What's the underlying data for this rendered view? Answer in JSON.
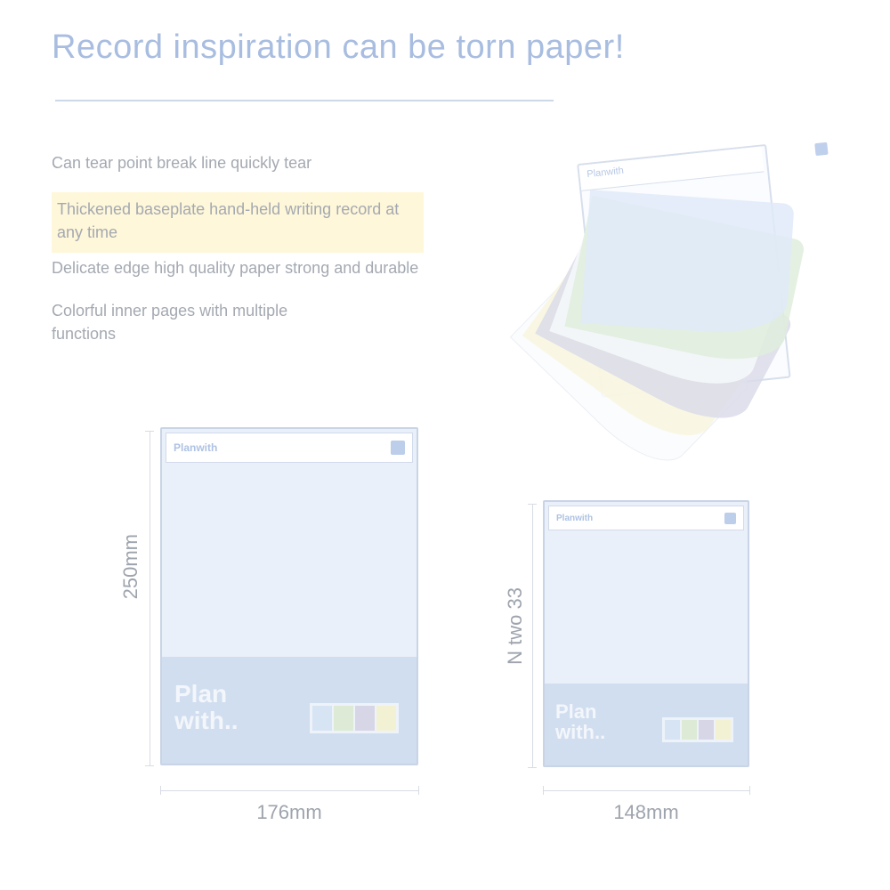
{
  "title": "Record inspiration can be torn paper!",
  "features": [
    "Can tear point break line quickly tear",
    "Thickened baseplate hand-held writing record at any time",
    "Delicate edge high quality paper strong and durable",
    "Colorful inner pages with multiple functions"
  ],
  "brand_small": "Planwith",
  "pad_logo_line1": "Plan",
  "pad_logo_line2": "with..",
  "products": {
    "a": {
      "height_label": "250mm",
      "width_label": "176mm"
    },
    "b": {
      "height_label": "N two 33",
      "width_label": "148mm"
    }
  }
}
